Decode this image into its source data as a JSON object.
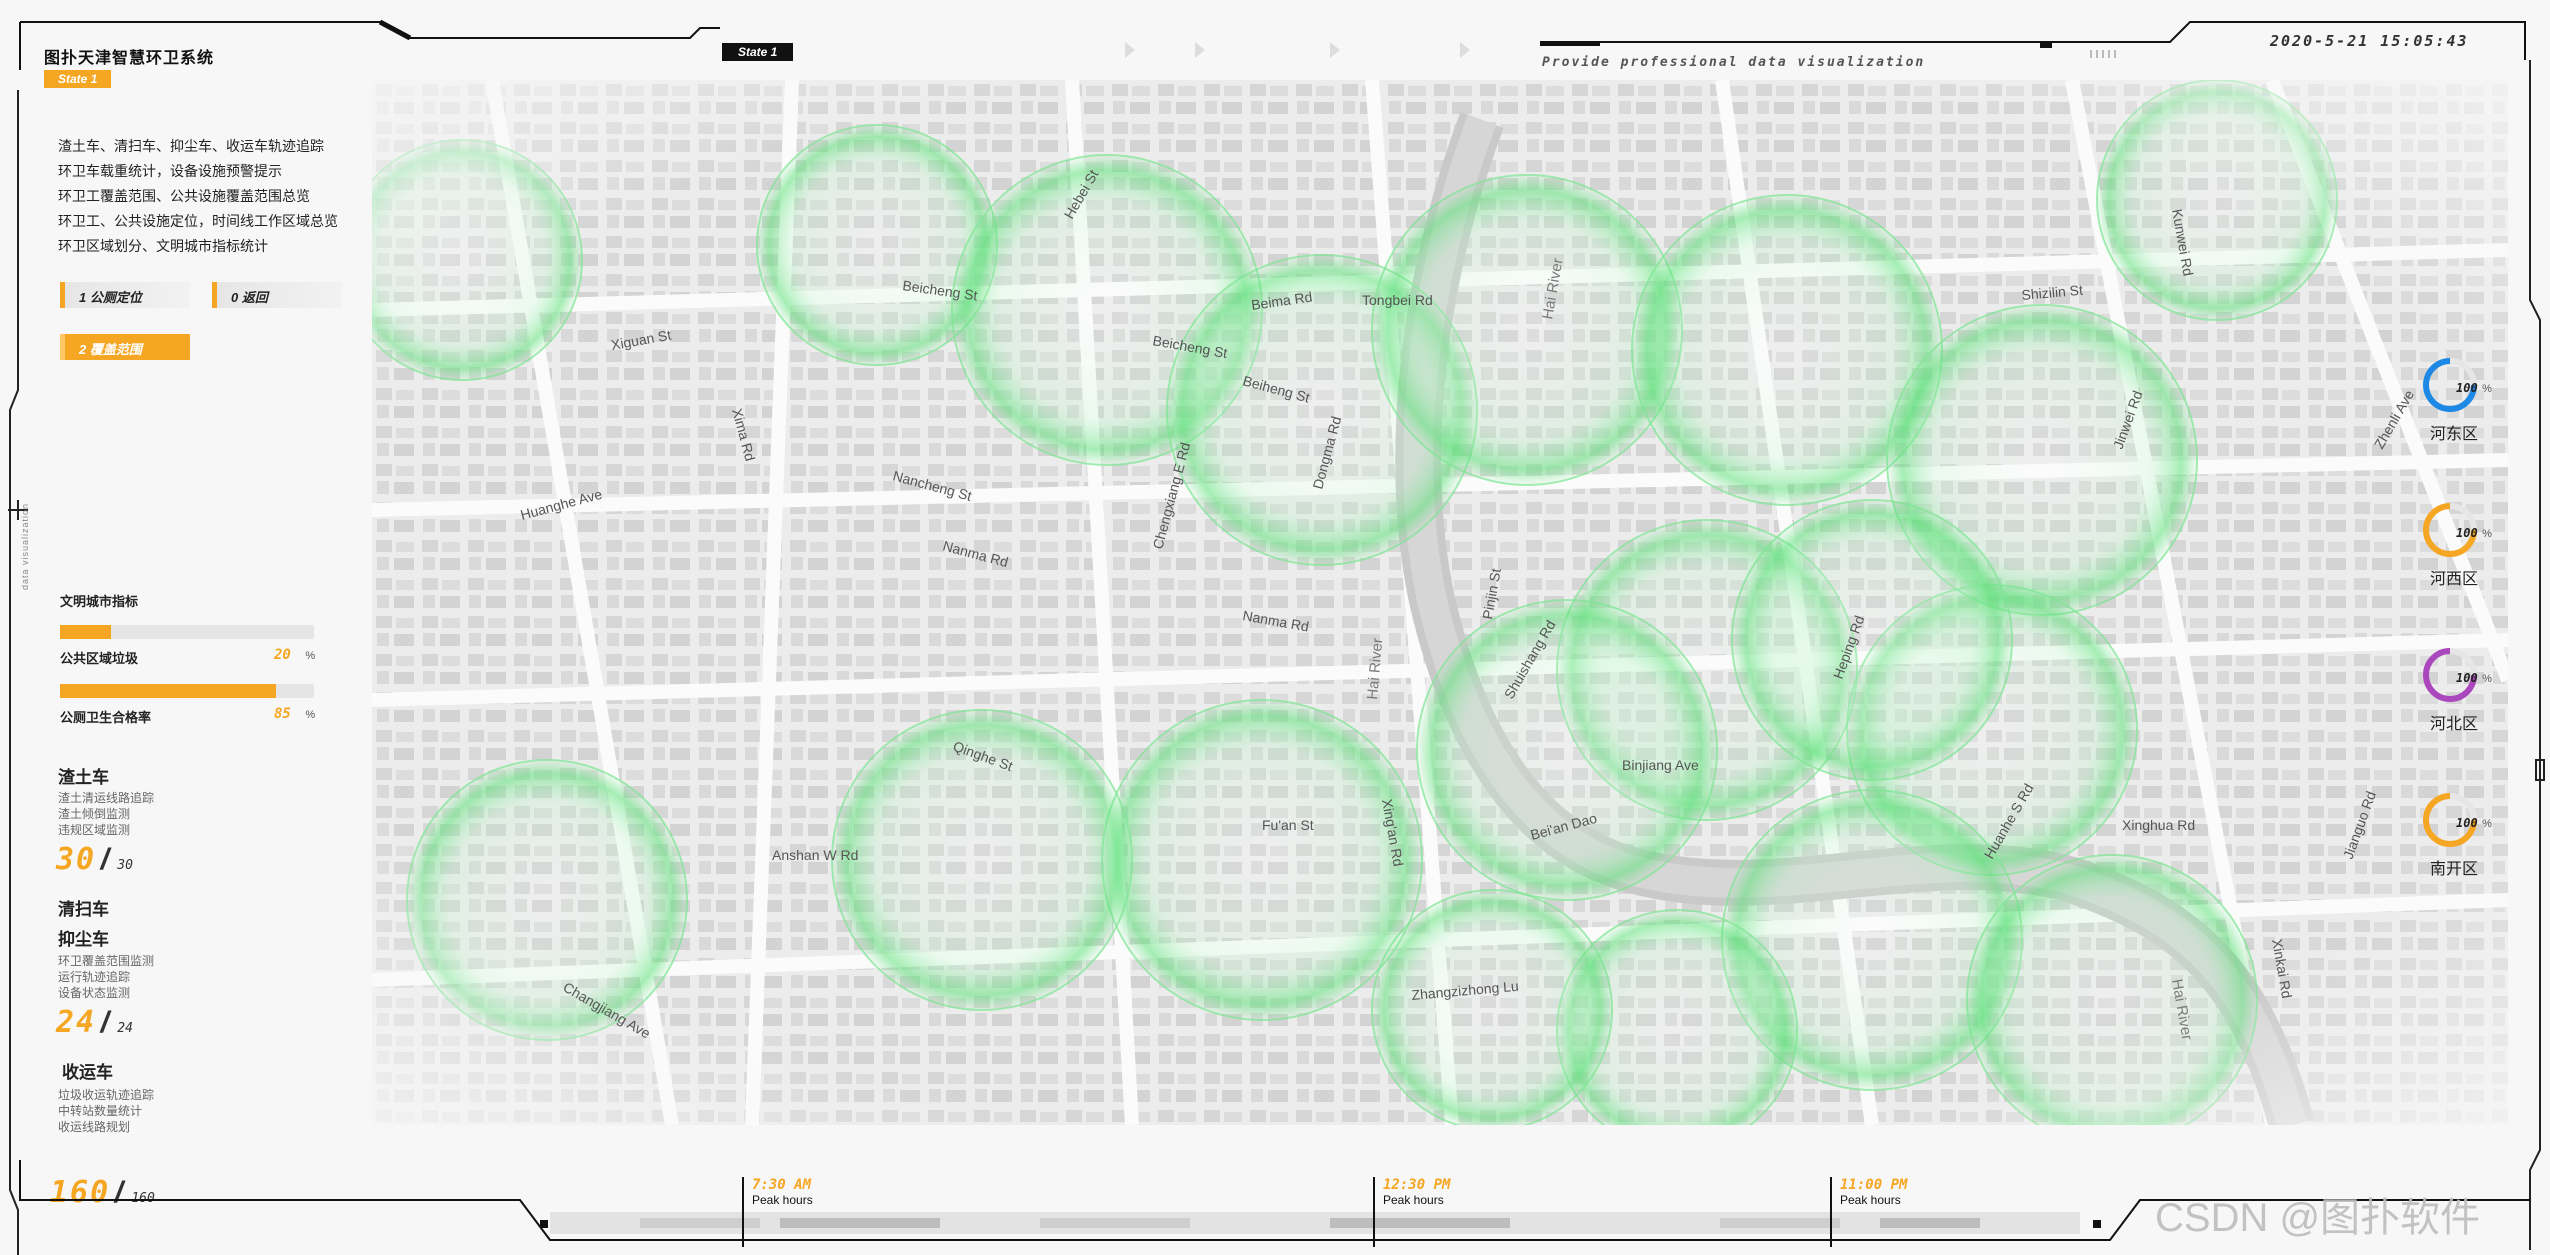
{
  "header": {
    "title": "图扑天津智慧环卫系统",
    "state_tag": "State 1",
    "state_black": "State 1",
    "subtitle": "Provide professional data visualization",
    "datetime": "2020-5-21 15:05:43"
  },
  "features": [
    "渣土车、清扫车、抑尘车、收运车轨迹追踪",
    "环卫车载重统计，设备设施预警提示",
    "环卫工覆盖范围、公共设施覆盖范围总览",
    "环卫工、公共设施定位，时间线工作区域总览",
    "环卫区域划分、文明城市指标统计"
  ],
  "buttons": {
    "public_toilet": "1  公厕定位",
    "back": "0  返回",
    "coverage": "2  覆盖范围"
  },
  "civil_index": {
    "title": "文明城市指标",
    "items": [
      {
        "label": "公共区域垃圾",
        "value": "20",
        "unit": "%",
        "percent": 20
      },
      {
        "label": "公厕卫生合格率",
        "value": "85",
        "unit": "%",
        "percent": 85
      }
    ]
  },
  "side_text": "data visualization",
  "vehicles": {
    "muck": {
      "title": "渣土车",
      "lines": [
        "渣土清运线路追踪",
        "渣土倾倒监测",
        "违规区域监测"
      ],
      "value": "30",
      "total": "30"
    },
    "sweeper": {
      "title": "清扫车",
      "title2": "抑尘车",
      "lines": [
        "环卫覆盖范围监测",
        "运行轨迹追踪",
        "设备状态监测"
      ],
      "value": "24",
      "total": "24"
    },
    "collector": {
      "title": "收运车",
      "lines": [
        "垃圾收运轨迹追踪",
        "中转站数量统计",
        "收运线路规划"
      ]
    },
    "total": {
      "value": "160",
      "total": "160"
    }
  },
  "districts": [
    {
      "name": "河东区",
      "value": "100",
      "unit": "%",
      "color": "#1e88e5"
    },
    {
      "name": "河西区",
      "value": "100",
      "unit": "%",
      "color": "#f5a623"
    },
    {
      "name": "河北区",
      "value": "100",
      "unit": "%",
      "color": "#ab47bc"
    },
    {
      "name": "南开区",
      "value": "100",
      "unit": "%",
      "color": "#f5a623"
    }
  ],
  "timeline": [
    {
      "time": "7:30  AM",
      "label": "Peak hours"
    },
    {
      "time": "12:30  PM",
      "label": "Peak hours"
    },
    {
      "time": "11:00  PM",
      "label": "Peak hours"
    }
  ],
  "map": {
    "river_labels": [
      "Hai River",
      "Hai River",
      "Hai River"
    ],
    "street_labels": [
      "Beicheng St",
      "Beima Rd",
      "Tongbei Rd",
      "Xiguan St",
      "Huanghe Ave",
      "Xima Rd",
      "Nancheng St",
      "Nanma Rd",
      "Nanma Rd",
      "Chengxiang E Rd",
      "Dongma Rd",
      "Hebei St",
      "Beicheng St",
      "Beiheng St",
      "Shizilin St",
      "Jinwei Rd",
      "Kunwei Rd",
      "Xinghua Rd",
      "Fu'an St",
      "Xing'an Rd",
      "Binjiang Ave",
      "Heping Rd",
      "Zhangzizhong Lu",
      "Bei'an Dao",
      "Qinghe St",
      "Changjiang Ave",
      "Anshan W Rd",
      "Pinjin St",
      "Shuishang Rd",
      "Huanhe S Rd",
      "Zhenli Ave",
      "Xinkai Rd",
      "Jianguo Rd"
    ],
    "credit": "CSDN @图扑软件"
  },
  "colors": {
    "accent": "#f5a623",
    "coverage": "#5ee27a"
  }
}
